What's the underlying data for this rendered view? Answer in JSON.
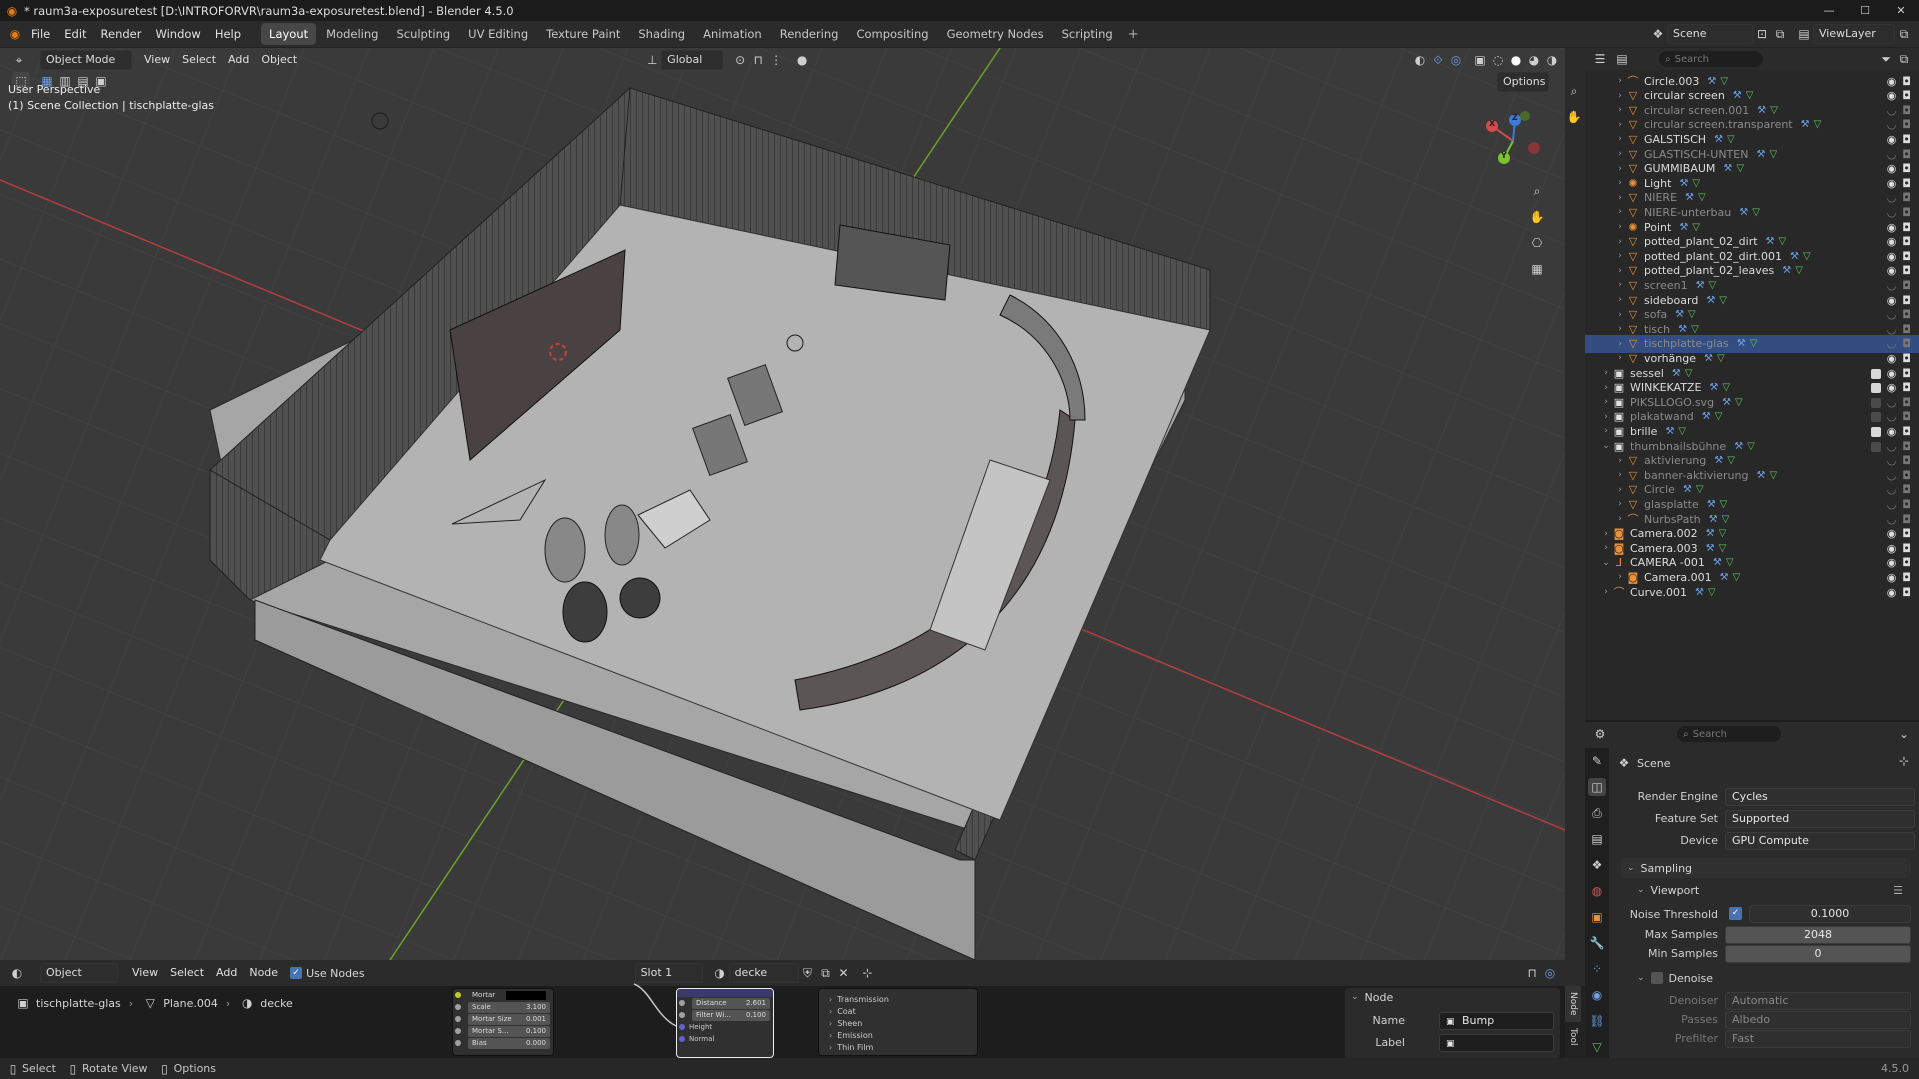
{
  "title": "* raum3a-exposuretest [D:\\INTROFORVR\\raum3a-exposuretest.blend] - Blender 4.5.0",
  "menu": [
    "File",
    "Edit",
    "Render",
    "Window",
    "Help"
  ],
  "workspaces": [
    "Layout",
    "Modeling",
    "Sculpting",
    "UV Editing",
    "Texture Paint",
    "Shading",
    "Animation",
    "Rendering",
    "Compositing",
    "Geometry Nodes",
    "Scripting"
  ],
  "active_workspace": "Layout",
  "scene_name": "Scene",
  "view_layer": "ViewLayer",
  "viewport": {
    "mode": "Object Mode",
    "menus": [
      "View",
      "Select",
      "Add",
      "Object"
    ],
    "orientation": "Global",
    "options_label": "Options",
    "perspective": "User Perspective",
    "collection_info": "(1) Scene Collection | tischplatte-glas",
    "gizmo_x": "X",
    "gizmo_y": "Y",
    "gizmo_z": "Z"
  },
  "outliner": {
    "search_placeholder": "Search",
    "rows": [
      {
        "name": "Circle.003",
        "icon": "curve",
        "depth": 1,
        "dim": false
      },
      {
        "name": "circular screen",
        "icon": "mesh",
        "depth": 1,
        "dim": false
      },
      {
        "name": "circular screen.001",
        "icon": "mesh",
        "depth": 1,
        "dim": true
      },
      {
        "name": "circular screen.transparent",
        "icon": "mesh",
        "depth": 1,
        "dim": true
      },
      {
        "name": "GALSTISCH",
        "icon": "mesh",
        "depth": 1,
        "dim": false
      },
      {
        "name": "GLASTISCH-UNTEN",
        "icon": "mesh",
        "depth": 1,
        "dim": true
      },
      {
        "name": "GUMMIBAUM",
        "icon": "mesh",
        "depth": 1,
        "dim": false
      },
      {
        "name": "Light",
        "icon": "light",
        "depth": 1,
        "dim": false
      },
      {
        "name": "NIERE",
        "icon": "mesh",
        "depth": 1,
        "dim": true
      },
      {
        "name": "NIERE-unterbau",
        "icon": "mesh",
        "depth": 1,
        "dim": true
      },
      {
        "name": "Point",
        "icon": "light",
        "depth": 1,
        "dim": false
      },
      {
        "name": "potted_plant_02_dirt",
        "icon": "mesh",
        "depth": 1,
        "dim": false
      },
      {
        "name": "potted_plant_02_dirt.001",
        "icon": "mesh",
        "depth": 1,
        "dim": false
      },
      {
        "name": "potted_plant_02_leaves",
        "icon": "mesh",
        "depth": 1,
        "dim": false
      },
      {
        "name": "screen1",
        "icon": "mesh",
        "depth": 1,
        "dim": true
      },
      {
        "name": "sideboard",
        "icon": "mesh",
        "depth": 1,
        "dim": false
      },
      {
        "name": "sofa",
        "icon": "mesh",
        "depth": 1,
        "dim": true
      },
      {
        "name": "tisch",
        "icon": "mesh",
        "depth": 1,
        "dim": true
      },
      {
        "name": "tischplatte-glas",
        "icon": "mesh",
        "depth": 1,
        "dim": true,
        "selected": true
      },
      {
        "name": "vorhänge",
        "icon": "mesh",
        "depth": 1,
        "dim": false
      },
      {
        "name": "sessel",
        "icon": "collection",
        "depth": 0,
        "dim": false
      },
      {
        "name": "WINKEKATZE",
        "icon": "collection",
        "depth": 0,
        "dim": false
      },
      {
        "name": "PIKSLLOGO.svg",
        "icon": "collection",
        "depth": 0,
        "dim": true
      },
      {
        "name": "plakatwand",
        "icon": "collection",
        "depth": 0,
        "dim": true
      },
      {
        "name": "brille",
        "icon": "collection",
        "depth": 0,
        "dim": false
      },
      {
        "name": "thumbnailsbühne",
        "icon": "collection",
        "depth": 0,
        "dim": true,
        "open": true
      },
      {
        "name": "aktivierung",
        "icon": "mesh",
        "depth": 1,
        "dim": true
      },
      {
        "name": "banner-aktivierung",
        "icon": "mesh",
        "depth": 1,
        "dim": true
      },
      {
        "name": "Circle",
        "icon": "mesh",
        "depth": 1,
        "dim": true
      },
      {
        "name": "glasplatte",
        "icon": "mesh",
        "depth": 1,
        "dim": true
      },
      {
        "name": "NurbsPath",
        "icon": "curve",
        "depth": 1,
        "dim": true
      },
      {
        "name": "Camera.002",
        "icon": "camera",
        "depth": 0,
        "dim": false
      },
      {
        "name": "Camera.003",
        "icon": "camera",
        "depth": 0,
        "dim": false
      },
      {
        "name": "CAMERA -001",
        "icon": "empty",
        "depth": 0,
        "dim": false,
        "open": true
      },
      {
        "name": "Camera.001",
        "icon": "camera",
        "depth": 1,
        "dim": false
      },
      {
        "name": "Curve.001",
        "icon": "curve",
        "depth": 0,
        "dim": false
      }
    ]
  },
  "properties": {
    "search_placeholder": "Search",
    "header": "Scene",
    "render_engine_label": "Render Engine",
    "render_engine": "Cycles",
    "feature_set_label": "Feature Set",
    "feature_set": "Supported",
    "device_label": "Device",
    "device": "GPU Compute",
    "sampling": "Sampling",
    "viewport": "Viewport",
    "noise_threshold_label": "Noise Threshold",
    "noise_threshold": "0.1000",
    "max_samples_label": "Max Samples",
    "max_samples": "2048",
    "min_samples_label": "Min Samples",
    "min_samples": "0",
    "denoise": "Denoise",
    "denoiser_label": "Denoiser",
    "denoiser": "Automatic",
    "passes_label": "Passes",
    "passes": "Albedo",
    "prefilter_label": "Prefilter",
    "prefilter": "Fast"
  },
  "node_editor": {
    "mode": "Object",
    "menus": [
      "View",
      "Select",
      "Add",
      "Node"
    ],
    "use_nodes": "Use Nodes",
    "slot": "Slot 1",
    "material": "decke",
    "breadcrumb": [
      "tischplatte-glas",
      "Plane.004",
      "decke"
    ],
    "node_panel_title": "Node",
    "name_label": "Name",
    "name_value": "Bump",
    "label_label": "Label",
    "label_value": "",
    "tab_node": "Node",
    "tab_tool": "Tool",
    "brick_node": [
      {
        "label": "Mortar",
        "value": ""
      },
      {
        "label": "Scale",
        "value": "3.100"
      },
      {
        "label": "Mortar Size",
        "value": "0.001"
      },
      {
        "label": "Mortar S...",
        "value": "0.100"
      },
      {
        "label": "Bias",
        "value": "0.000"
      }
    ],
    "bump_node": [
      {
        "label": "Distance",
        "value": "2.601"
      },
      {
        "label": "Filter Wi...",
        "value": "0.100"
      },
      {
        "label": "Height",
        "value": ""
      },
      {
        "label": "Normal",
        "value": ""
      }
    ],
    "bsdf_panels": [
      "Transmission",
      "Coat",
      "Sheen",
      "Emission",
      "Thin Film"
    ]
  },
  "status": {
    "select": "Select",
    "rotate": "Rotate View",
    "options": "Options",
    "version": "4.5.0"
  },
  "colors": {
    "accent": "#4772b3",
    "selected_row": "#334d80",
    "x_axis": "#d24a4a",
    "y_axis": "#7cc22e",
    "z_axis": "#3d7bd6"
  }
}
